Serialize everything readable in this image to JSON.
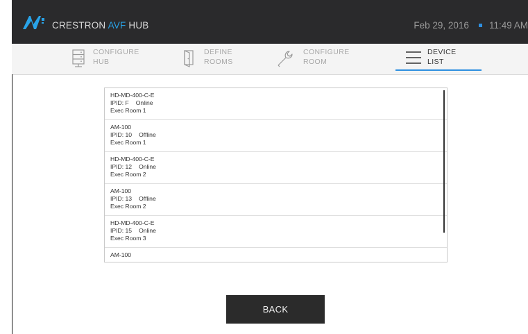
{
  "header": {
    "brand_prefix": "CRESTRON",
    "brand_accent": "AVF",
    "brand_suffix": "HUB",
    "date": "Feb 29, 2016",
    "time": "11:49 AM",
    "logo_icon": "crestron-logo-icon",
    "accent_color": "#29a3e8"
  },
  "tabs": [
    {
      "label": "CONFIGURE\nHUB",
      "icon": "server-icon",
      "active": false
    },
    {
      "label": "DEFINE\nROOMS",
      "icon": "door-icon",
      "active": false
    },
    {
      "label": "CONFIGURE\nROOM",
      "icon": "wrench-icon",
      "active": false
    },
    {
      "label": "DEVICE\nLIST",
      "icon": "list-icon",
      "active": true
    }
  ],
  "devices": [
    {
      "model": "HD-MD-400-C-E",
      "ipid": "IPID: F",
      "status": "Online",
      "room": "Exec Room 1"
    },
    {
      "model": "AM-100",
      "ipid": "IPID: 10",
      "status": "Offline",
      "room": "Exec Room 1"
    },
    {
      "model": "HD-MD-400-C-E",
      "ipid": "IPID: 12",
      "status": "Online",
      "room": "Exec Room 2"
    },
    {
      "model": "AM-100",
      "ipid": "IPID: 13",
      "status": "Offline",
      "room": "Exec Room 2"
    },
    {
      "model": "HD-MD-400-C-E",
      "ipid": "IPID: 15",
      "status": "Online",
      "room": "Exec Room 3"
    },
    {
      "model": "AM-100",
      "ipid": "",
      "status": "",
      "room": ""
    }
  ],
  "back_label": "BACK"
}
